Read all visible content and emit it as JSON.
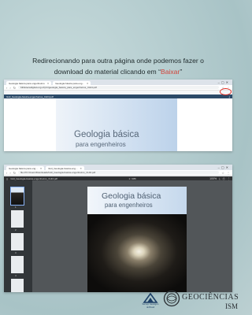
{
  "caption": {
    "text_before": "Redirecionando para outra página onde podemos fazer o download do material clicando em “",
    "highlight": "Baixar",
    "text_after": "”"
  },
  "window1": {
    "tab1": "Geologia básica para engenheiros",
    "tab2": "Geologia básica para eng...",
    "url": "bibliotecadigital.eng.ufrj.br/geologia_basica_para_engenheiros_CHI4.pdf",
    "file_name": "GHI_Geologia-basica-engenheiros_CHI4.pdf",
    "download_icon": "download-icon",
    "cover_title_line1": "Geologia básica",
    "cover_title_line2": "para engenheiros"
  },
  "window2": {
    "tab1": "Geologia básica para eng...",
    "tab2": "GHI_Geologia-basica-eng...",
    "url": "file:///C:/Users/Downloads/GHI_Geologia-basica-engenheiros_CHI4.pdf",
    "file_name": "GHI_Geologia-basica-engenheiros_CHI4.pdf",
    "page_indicator": "1 / 386",
    "zoom": "100%",
    "thumb_numbers": [
      "1",
      "2",
      "3",
      "4",
      "5"
    ],
    "cover_title_line1": "Geologia básica",
    "cover_title_line2": "para engenheiros"
  },
  "logos": {
    "cprm_line1": "Serviço Geológico",
    "cprm_line2": "do Brasil",
    "geociencias": "GEOCIÊNCIAS",
    "partial_text": "ISM"
  },
  "colors": {
    "highlight": "#d1453b",
    "circle": "#e0281e",
    "pdf_toolbar": "#2e2f31"
  }
}
